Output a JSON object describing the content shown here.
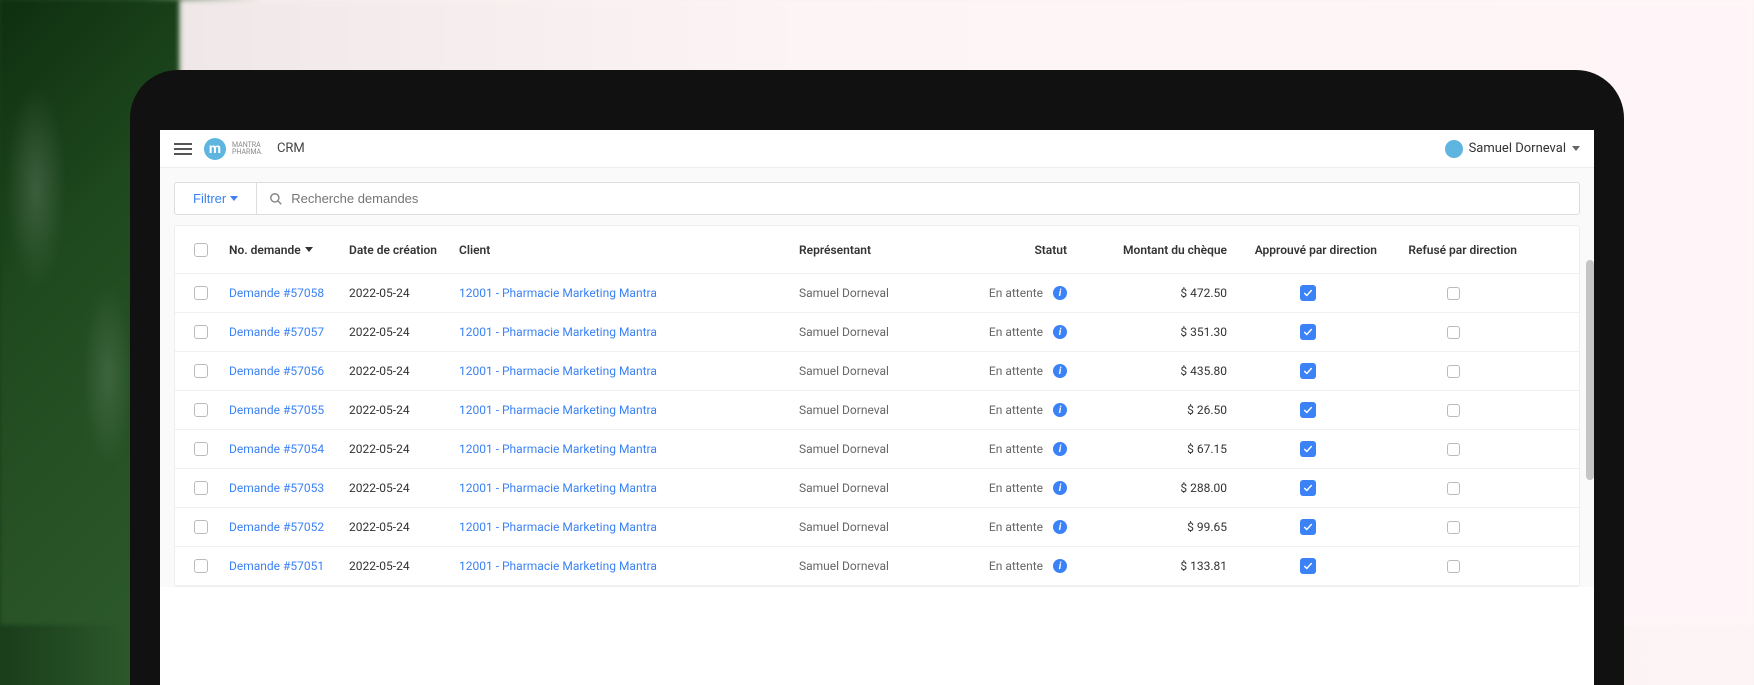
{
  "header": {
    "brand_line1": "MANTRA",
    "brand_line2": "PHARMA.",
    "app_name": "CRM",
    "user_name": "Samuel Dorneval"
  },
  "toolbar": {
    "filter_label": "Filtrer",
    "search_placeholder": "Recherche demandes"
  },
  "table": {
    "headers": {
      "no_demande": "No. demande",
      "date_creation": "Date de création",
      "client": "Client",
      "representant": "Représentant",
      "statut": "Statut",
      "montant": "Montant du chèque",
      "approuve": "Approuvé par direction",
      "refuse": "Refusé par direction"
    },
    "rows": [
      {
        "demande": "Demande #57058",
        "date": "2022-05-24",
        "client": "12001 - Pharmacie Marketing Mantra",
        "representant": "Samuel Dorneval",
        "statut": "En attente",
        "montant": "$ 472.50",
        "approuve": true,
        "refuse": false
      },
      {
        "demande": "Demande #57057",
        "date": "2022-05-24",
        "client": "12001 - Pharmacie Marketing Mantra",
        "representant": "Samuel Dorneval",
        "statut": "En attente",
        "montant": "$ 351.30",
        "approuve": true,
        "refuse": false
      },
      {
        "demande": "Demande #57056",
        "date": "2022-05-24",
        "client": "12001 - Pharmacie Marketing Mantra",
        "representant": "Samuel Dorneval",
        "statut": "En attente",
        "montant": "$ 435.80",
        "approuve": true,
        "refuse": false
      },
      {
        "demande": "Demande #57055",
        "date": "2022-05-24",
        "client": "12001 - Pharmacie Marketing Mantra",
        "representant": "Samuel Dorneval",
        "statut": "En attente",
        "montant": "$ 26.50",
        "approuve": true,
        "refuse": false
      },
      {
        "demande": "Demande #57054",
        "date": "2022-05-24",
        "client": "12001 - Pharmacie Marketing Mantra",
        "representant": "Samuel Dorneval",
        "statut": "En attente",
        "montant": "$ 67.15",
        "approuve": true,
        "refuse": false
      },
      {
        "demande": "Demande #57053",
        "date": "2022-05-24",
        "client": "12001 - Pharmacie Marketing Mantra",
        "representant": "Samuel Dorneval",
        "statut": "En attente",
        "montant": "$ 288.00",
        "approuve": true,
        "refuse": false
      },
      {
        "demande": "Demande #57052",
        "date": "2022-05-24",
        "client": "12001 - Pharmacie Marketing Mantra",
        "representant": "Samuel Dorneval",
        "statut": "En attente",
        "montant": "$ 99.65",
        "approuve": true,
        "refuse": false
      },
      {
        "demande": "Demande #57051",
        "date": "2022-05-24",
        "client": "12001 - Pharmacie Marketing Mantra",
        "representant": "Samuel Dorneval",
        "statut": "En attente",
        "montant": "$ 133.81",
        "approuve": true,
        "refuse": false
      }
    ]
  }
}
